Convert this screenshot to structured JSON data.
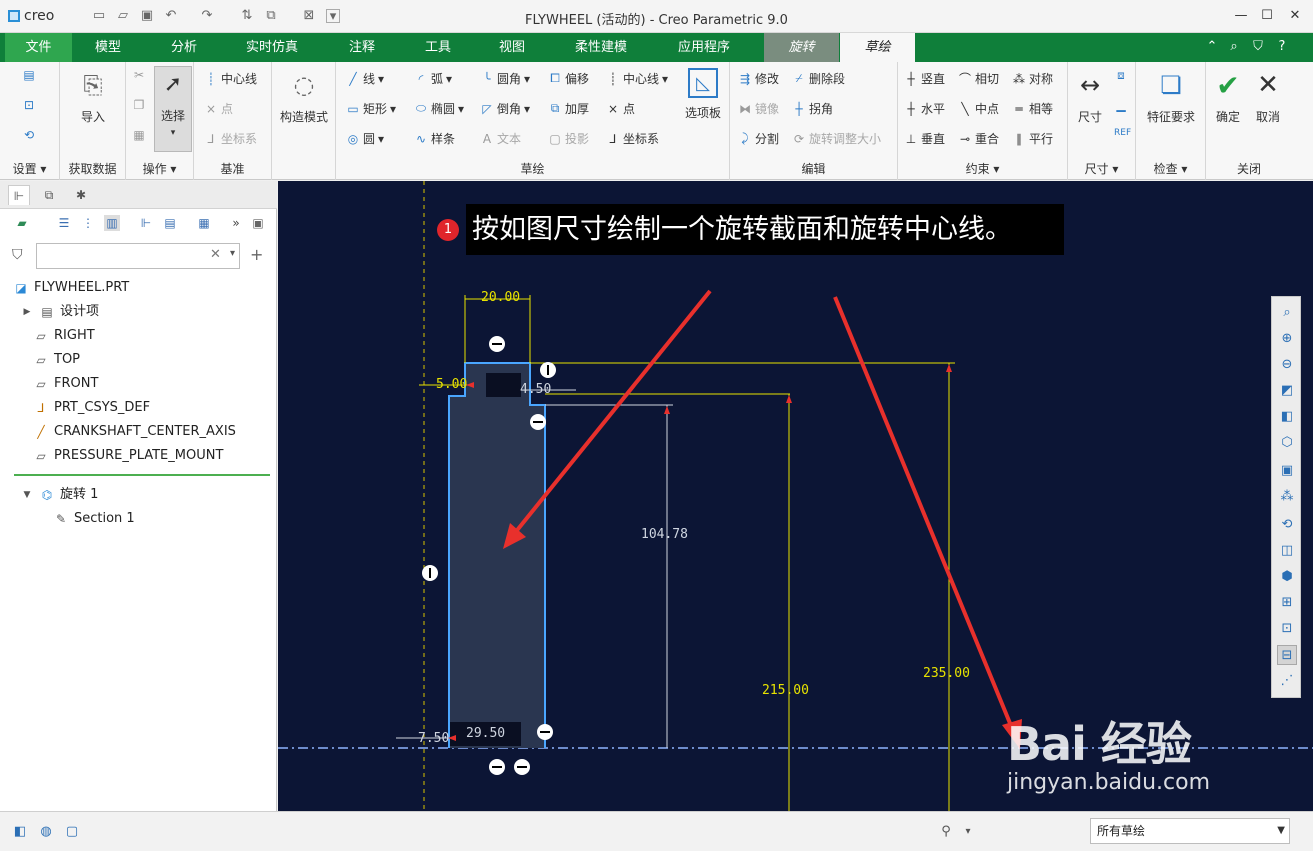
{
  "app": {
    "logo": "creo",
    "window_title": "FLYWHEEL (活动的) - Creo Parametric 9.0",
    "window_buttons": [
      "—",
      "☐",
      "✕"
    ]
  },
  "tabs": [
    "文件",
    "模型",
    "分析",
    "实时仿真",
    "注释",
    "工具",
    "视图",
    "柔性建模",
    "应用程序",
    "旋转",
    "草绘"
  ],
  "ribbon": {
    "setup": {
      "label": "设置 ▾"
    },
    "get_data": {
      "import": "导入",
      "label": "获取数据"
    },
    "operations": {
      "select": "选择",
      "label": "操作 ▾"
    },
    "datum": {
      "centerline": "中心线",
      "point": "点",
      "csys": "坐标系",
      "label": "基准"
    },
    "construction": {
      "label": "构造模式"
    },
    "sketching": {
      "line": "线",
      "arc": "弧",
      "fillet": "圆角",
      "offset": "偏移",
      "centerline": "中心线",
      "rectangle": "矩形",
      "ellipse": "椭圆",
      "chamfer": "倒角",
      "thicken": "加厚",
      "point": "点",
      "circle": "圆",
      "spline": "样条",
      "text": "文本",
      "project": "投影",
      "csys": "坐标系",
      "palette": "选项板",
      "label": "草绘"
    },
    "editing": {
      "modify": "修改",
      "delete_segment": "删除段",
      "mirror": "镜像",
      "corner": "拐角",
      "divide": "分割",
      "rotate_resize": "旋转调整大小",
      "label": "编辑"
    },
    "constrain": {
      "vertical": "竖直",
      "tangent": "相切",
      "symmetric": "对称",
      "horizontal": "水平",
      "midpoint": "中点",
      "equal": "相等",
      "perpendicular": "垂直",
      "coincident": "重合",
      "parallel": "平行",
      "label": "约束 ▾"
    },
    "dimension": {
      "dimension": "尺寸",
      "label": "尺寸 ▾"
    },
    "inspect": {
      "feature_req": "特征要求",
      "label": "检查 ▾"
    },
    "close": {
      "ok": "确定",
      "cancel": "取消",
      "label": "关闭"
    }
  },
  "model_tree": {
    "items": [
      {
        "label": "FLYWHEEL.PRT",
        "icon": "part-icon"
      },
      {
        "label": "设计项",
        "icon": "design-items-icon"
      },
      {
        "label": "RIGHT",
        "icon": "plane-icon"
      },
      {
        "label": "TOP",
        "icon": "plane-icon"
      },
      {
        "label": "FRONT",
        "icon": "plane-icon"
      },
      {
        "label": "PRT_CSYS_DEF",
        "icon": "csys-icon"
      },
      {
        "label": "CRANKSHAFT_CENTER_AXIS",
        "icon": "axis-icon"
      },
      {
        "label": "PRESSURE_PLATE_MOUNT",
        "icon": "plane-icon"
      },
      {
        "label": "旋转 1",
        "icon": "revolve-icon"
      },
      {
        "label": "Section 1",
        "icon": "section-icon"
      }
    ]
  },
  "canvas": {
    "instruction": "按如图尺寸绘制一个旋转截面和旋转中心线。",
    "step": "1",
    "dims": {
      "width_top": "20.00",
      "left_step": "5.00",
      "right_step": "4.50",
      "height_inner": "104.78",
      "height_mid": "215.00",
      "height_outer": "235.00",
      "bottom_width": "29.50",
      "bottom_left": "7.50"
    }
  },
  "status": {
    "filter": "所有草绘"
  },
  "watermark": {
    "brand": "Bai 经验",
    "url": "jingyan.baidu.com"
  }
}
